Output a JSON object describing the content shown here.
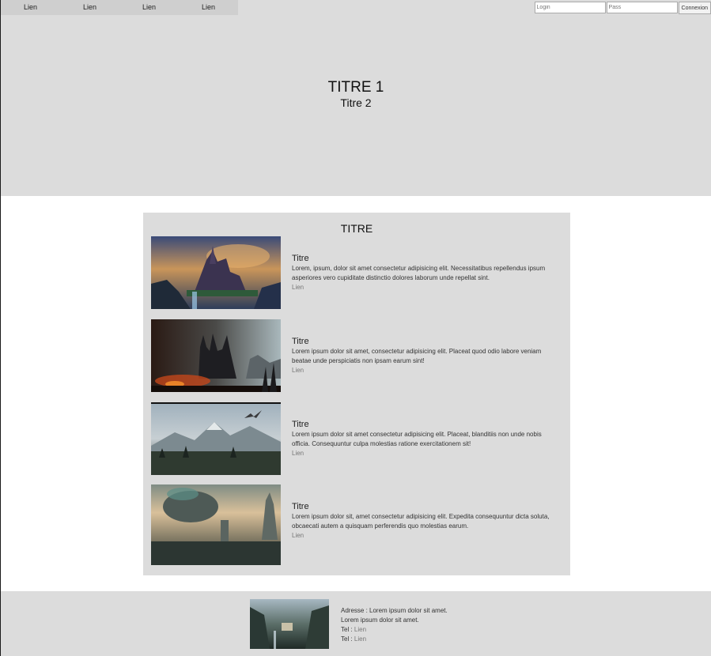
{
  "nav": {
    "links": [
      "Lien",
      "Lien",
      "Lien",
      "Lien"
    ]
  },
  "login": {
    "login_placeholder": "Login",
    "pass_placeholder": "Pass",
    "submit_label": "Connexion"
  },
  "hero": {
    "title1": "TITRE 1",
    "title2": "Titre 2"
  },
  "main": {
    "title": "TITRE",
    "articles": [
      {
        "title": "Titre",
        "text": "Lorem, ipsum, dolor sit amet consectetur adipisicing elit. Necessitatibus repellendus ipsum asperiores vero cupiditate distinctio dolores laborum unde repellat sint.",
        "link": "Lien"
      },
      {
        "title": "Titre",
        "text": "Lorem ipsum dolor sit amet, consectetur adipisicing elit. Placeat quod odio labore veniam beatae unde perspiciatis non ipsam earum sint!",
        "link": "Lien"
      },
      {
        "title": "Titre",
        "text": "Lorem ipsum dolor sit amet consectetur adipisicing elit. Placeat, blanditiis non unde nobis officia. Consequuntur culpa molestias ratione exercitationem sit!",
        "link": "Lien"
      },
      {
        "title": "Titre",
        "text": "Lorem ipsum dolor sit, amet consectetur adipisicing elit. Expedita consequuntur dicta soluta, obcaecati autem a quisquam perferendis quo molestias earum.",
        "link": "Lien"
      }
    ]
  },
  "footer": {
    "address": "Adresse : Lorem ipsum dolor sit amet.",
    "address2": "Lorem ipsum dolor sit amet.",
    "tel_label": "Tel :",
    "tel1_link": "Lien",
    "tel2_link": "Lien"
  },
  "colors": {
    "background": "#dcdcdc",
    "nav_background": "#cfcfcf",
    "link": "#777777"
  }
}
